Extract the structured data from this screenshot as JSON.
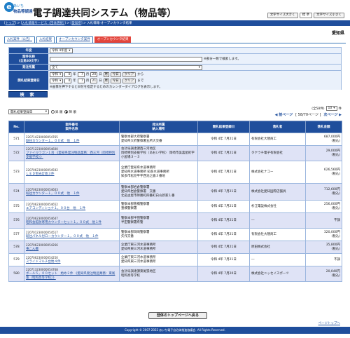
{
  "header": {
    "logo_main": "e",
    "logo_sub1": "あいち",
    "logo_sub2": "物品等調達",
    "title": "電子調達共同システム（物品等）",
    "buttons": [
      "文字サイズ大きく",
      "標 準",
      "文字サイズ小さく"
    ]
  },
  "breadcrumb": {
    "parts": [
      "トップ",
      "入札情報サービス（団体選択）",
      "愛知県",
      "入札情報-オープンカウンタ結果"
    ],
    "text": "[トップ] > [入札情報サービス（団体選択）] > [愛知県] > 入札情報-オープンカウンタ結果"
  },
  "region": "愛知県",
  "tabs": [
    "入札案件（公告）",
    "入札結果",
    "オープンカウンタ案件",
    "オープンカウンタ結果"
  ],
  "form": {
    "year_label": "年度",
    "year_value": "令和 4年度",
    "name_label": "案件名称",
    "name_sub": "(全角30文字)",
    "name_note": "※部分一致で検索します。",
    "org_label": "発注所属",
    "org_value": "全て",
    "date_label": "開札結果登録日",
    "era": "令和",
    "from": {
      "y": "4",
      "m": "7",
      "d": "20"
    },
    "to": {
      "y": "4",
      "m": "7",
      "d": "21"
    },
    "cal": "暦",
    "today_btn": "今日",
    "clear_btn": "クリア",
    "from_label": "から",
    "to_label": "まで",
    "units": {
      "y": "年",
      "m": "月",
      "d": "日"
    },
    "cal_note": "※画像を押下すると日付を指定するためのカレンダーダイアログを表示します。",
    "search_btn": "検 索"
  },
  "list": {
    "sort_value": "開札結果登録日",
    "asc": "昇 順",
    "desc": "降 順",
    "total": "(全58件)",
    "per_page": "10",
    "per_page_unit": "件",
    "prev": "前ページ",
    "pages": "[ 58/70ページ ]",
    "next": "次ページ"
  },
  "table": {
    "headers": [
      "No.",
      "案件番号\n案件名称",
      "発注所属\n納入場所",
      "開札結果登録日",
      "落札者",
      "落札金額"
    ],
    "rows": [
      {
        "no": "571",
        "case_no": "220714230000054765",
        "name": "既往カウンター１，００式　他　１件",
        "org": "警察本部大府警察署\n愛知県大府警察署五所大交番",
        "date": "令和 4年 7月21日",
        "winner": "有限会社大隈商工",
        "amount": "687,000円",
        "amount_note": "(税込)"
      },
      {
        "no": "572",
        "case_no": "220712230000054600",
        "name": "ファイルワゴン１台 《愛知県発注物品業務：西三河（岡崎特別支援学校）》",
        "org": "会計局調達課西三河地区\n岡崎特別支援学校（あおい学校） 岡崎市美喜屋町字小屋場３－３",
        "date": "令和 4年 7月21日",
        "winner": "タケウチ電子有限会社",
        "amount": "29,000円",
        "amount_note": "(税込)"
      },
      {
        "no": "573",
        "case_no": "220706230000054592",
        "name": "ＬＥＤ蛍光灯始３件",
        "org": "企業庁愛知県水道事務所\n愛知県水道事務所 知多水道事務所\n知多市松見平字西池之脇３番地",
        "date": "令和 4年 7月21日",
        "winner": "株式会社ナコー",
        "amount": "626,560円",
        "amount_note": "(税込)"
      },
      {
        "no": "574",
        "case_no": "220706230000054603",
        "name": "既往カウンター１，００式　他　１件",
        "org": "警察本部岩倉警察署\n愛知県岩倉警察署　交番\n北名古屋市師勝町四番町白山新家１番",
        "date": "令和 4年 7月21日",
        "winner": "株式会社愛知国際店舗具",
        "amount": "712,600円",
        "amount_note": "(税込)"
      },
      {
        "no": "575",
        "case_no": "220706230000054652",
        "name": "エアコンディショナ１，００台　他　１件",
        "org": "警察本部豊橋警察署\n豊橋警察署",
        "date": "令和 4年 7月21日",
        "winner": "杉江電設株式会社",
        "amount": "256,000円",
        "amount_note": "(税込)"
      },
      {
        "no": "576",
        "case_no": "220706230000054647",
        "name": "昭和会館防寒用カウンターセット１，００式　他１件",
        "org": "警察本部半田警察署\n半田警察署県警",
        "date": "令和 4年 7月21日",
        "winner": "―",
        "amount": "不調",
        "amount_note": ""
      },
      {
        "no": "577",
        "case_no": "220701230000054517",
        "name": "既往パネル付ローカウンター１，００式　他　１件",
        "org": "警察本部岡崎警察署\n矢作交番",
        "date": "令和 4年 7月21日",
        "winner": "有限会社大隈商工",
        "amount": "320,000円",
        "amount_note": "(税込)"
      },
      {
        "no": "578",
        "case_no": "220706230000054266",
        "name": "事こん機",
        "org": "企業庁東三河水道事務所\n愛知県東三河水道事務所",
        "date": "令和 4年 7月21日",
        "winner": "原田株式会社",
        "amount": "35,800円",
        "amount_note": "(税込)"
      },
      {
        "no": "579",
        "case_no": "220706230000054250",
        "name": "スライドマルチ台始４件",
        "org": "企業庁東三河水道事務所\n愛知県東三河水道事務所",
        "date": "令和 4年 7月21日",
        "winner": "―",
        "amount": "不調",
        "amount_note": ""
      },
      {
        "no": "580",
        "case_no": "220713230000054768",
        "name": "ボール５，００セット　始め２件 《愛知県発注物品業務：東尾張（昭和高等学校）》",
        "org": "会計局調達課東尾張地区\n昭和高等学校",
        "date": "令和 4年 7月20日",
        "winner": "株式会社ニッセイスポーツ",
        "amount": "20,040円",
        "amount_note": "(税込)"
      }
    ]
  },
  "top_button": "団体のトップページへ戻る",
  "page_top": "ページトップへ",
  "footer": "Copyright © 2007-2022 あいち電子自治体推進協議会. All Rights Reserved."
}
